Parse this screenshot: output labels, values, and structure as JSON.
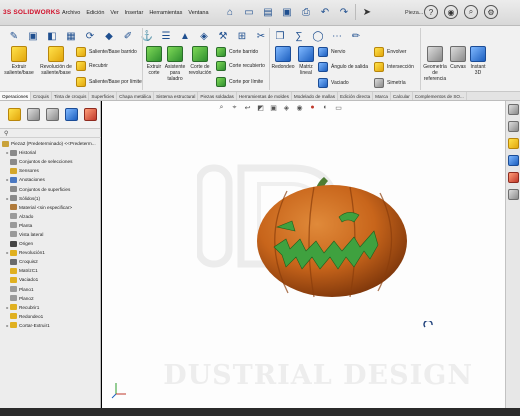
{
  "app": {
    "logo_prefix": "3S",
    "logo_name": "SOLIDWORKS",
    "document_title": "Pieza...",
    "menu": [
      "Archivo",
      "Edición",
      "Ver",
      "Insertar",
      "Herramientas",
      "Ventana"
    ]
  },
  "ribbon": {
    "extrude_boss": "Extruir saliente/base",
    "revolve_boss": "Revolución de saliente/base",
    "swept_boss": "Saliente/Base barrido",
    "lofted_boss": "Recubrir",
    "boundary_boss": "Saliente/Base por límite",
    "extruded_cut": "Extruir corte",
    "hole_wizard": "Asistente para taladro",
    "revolved_cut": "Corte de revolución",
    "swept_cut": "Corte barrido",
    "lofted_cut": "Corte recubierto",
    "boundary_cut": "Corte por límite",
    "fillet": "Redondeo",
    "linear_pattern": "Matriz lineal",
    "rib": "Nervio",
    "draft": "Ángulo de salida",
    "shell": "Vaciado",
    "wrap": "Envolver",
    "intersect": "Intersección",
    "mirror": "Simetría",
    "ref_geometry": "Geometría de referencia",
    "curves": "Curvas",
    "instant3d": "Instant 3D"
  },
  "tabs": [
    "Operaciones",
    "Croquis",
    "Tinta de croquis",
    "Superficies",
    "Chapa metálica",
    "Sistema estructural",
    "Piezas soldadas",
    "Herramientas de moldes",
    "Modelado de mallas",
    "Edición directa",
    "Marca",
    "Calcular",
    "Complementos de SO..."
  ],
  "tree": [
    {
      "label": "Pieza2 (Predeterminado) <<Predeterm...",
      "level": 0,
      "arrow": "",
      "color": "#c9a23a"
    },
    {
      "label": "Historial",
      "level": 1,
      "arrow": "▸",
      "color": "#8a8a8a"
    },
    {
      "label": "Conjuntos de selecciones",
      "level": 1,
      "arrow": "",
      "color": "#8a8a8a"
    },
    {
      "label": "Sensores",
      "level": 1,
      "arrow": "",
      "color": "#d4a72c"
    },
    {
      "label": "Anotaciones",
      "level": 1,
      "arrow": "▸",
      "color": "#4a78c2"
    },
    {
      "label": "Conjuntos de superficies",
      "level": 1,
      "arrow": "",
      "color": "#8a8a8a"
    },
    {
      "label": "Sólidos(1)",
      "level": 1,
      "arrow": "▸",
      "color": "#8a8a8a"
    },
    {
      "label": "Material <sin especificar>",
      "level": 1,
      "arrow": "",
      "color": "#b07a3a"
    },
    {
      "label": "Alzado",
      "level": 1,
      "arrow": "",
      "color": "#9a9a9a"
    },
    {
      "label": "Planta",
      "level": 1,
      "arrow": "",
      "color": "#9a9a9a"
    },
    {
      "label": "Vista lateral",
      "level": 1,
      "arrow": "",
      "color": "#9a9a9a"
    },
    {
      "label": "Origen",
      "level": 1,
      "arrow": "",
      "color": "#444444"
    },
    {
      "label": "Revolución1",
      "level": 1,
      "arrow": "▸",
      "color": "#e0b020"
    },
    {
      "label": "Croquis2",
      "level": 1,
      "arrow": "",
      "color": "#6a6a6a"
    },
    {
      "label": "MatrizC1",
      "level": 1,
      "arrow": "",
      "color": "#e0b020"
    },
    {
      "label": "Vaciado1",
      "level": 1,
      "arrow": "",
      "color": "#e0b020"
    },
    {
      "label": "Plano1",
      "level": 1,
      "arrow": "",
      "color": "#9a9a9a"
    },
    {
      "label": "Plano2",
      "level": 1,
      "arrow": "",
      "color": "#9a9a9a"
    },
    {
      "label": "Recubrir1",
      "level": 1,
      "arrow": "▸",
      "color": "#e0b020"
    },
    {
      "label": "Redondeo1",
      "level": 1,
      "arrow": "",
      "color": "#e0b020"
    },
    {
      "label": "Cortar-Extruir1",
      "level": 1,
      "arrow": "▸",
      "color": "#e0b020"
    }
  ],
  "graphics": {
    "watermark_text": "DUSTRIAL DESIGN",
    "background": "#fdfdfd"
  },
  "colors": {
    "pumpkin": "#c8651b",
    "pumpkin_dark": "#8a3d0b",
    "stem": "#4f7d33",
    "face": "#3fa13f"
  }
}
